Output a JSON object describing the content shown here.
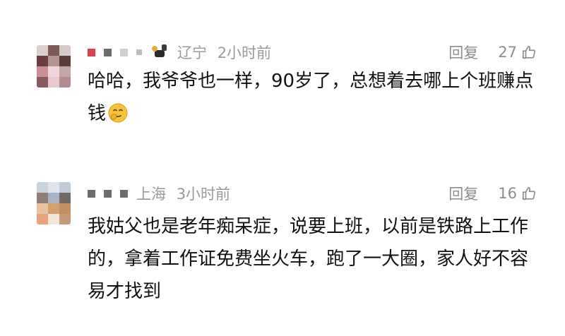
{
  "comments": [
    {
      "location": "辽宁",
      "time": "2小时前",
      "reply_label": "回复",
      "like_count": "27",
      "text": "哈哈，我爷爷也一样，90岁了，总想着去哪上个班赚点钱",
      "emoji": "thinking-face"
    },
    {
      "location": "上海",
      "time": "3小时前",
      "reply_label": "回复",
      "like_count": "16",
      "text": "我姑父也是老年痴呆症，说要上班，以前是铁路上工作的，拿着工作证免费坐火车，跑了一大圈，家人好不容易才找到"
    }
  ],
  "colors": {
    "meta": "#9a9a9a",
    "text": "#111111",
    "action": "#8c8c8c"
  }
}
